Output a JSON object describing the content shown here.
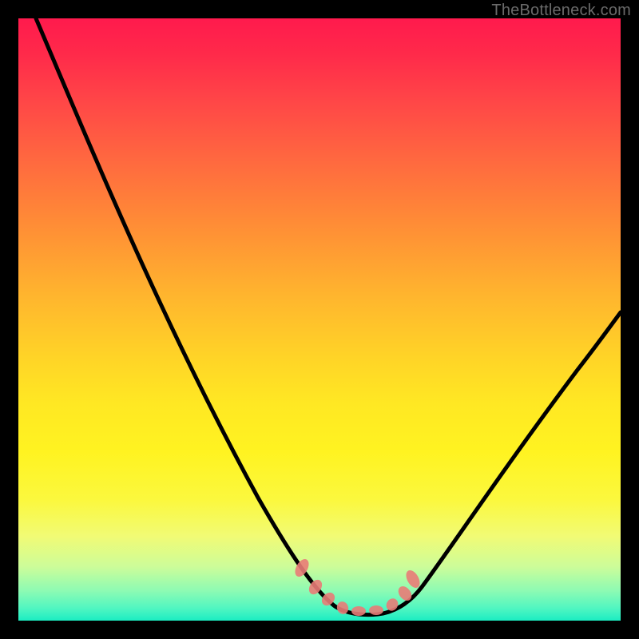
{
  "watermark": "TheBottleneck.com",
  "colors": {
    "frame": "#000000",
    "curve": "#000000",
    "salmon": "#e97b77",
    "gradient_stops": [
      "#ff1a4d",
      "#ff2a4a",
      "#ff4747",
      "#ff6a3f",
      "#ff8c36",
      "#ffb52e",
      "#ffd327",
      "#ffe823",
      "#fff321",
      "#fbf83e",
      "#f1fb75",
      "#cdfc99",
      "#8efbb3",
      "#4ff6c1",
      "#1bedc2"
    ]
  },
  "chart_data": {
    "type": "line",
    "title": "",
    "xlabel": "",
    "ylabel": "",
    "xlim": [
      0,
      100
    ],
    "ylim": [
      0,
      100
    ],
    "grid": false,
    "legend_position": "none",
    "series": [
      {
        "name": "bottleneck-curve",
        "x": [
          3,
          8,
          13,
          18,
          23,
          28,
          33,
          38,
          42,
          45,
          48,
          51,
          53,
          55,
          57,
          60,
          63,
          67,
          72,
          78,
          85,
          92,
          100
        ],
        "y": [
          100,
          91,
          82,
          73,
          64,
          55,
          46,
          37,
          28,
          20,
          13,
          7,
          4,
          2,
          2,
          2,
          3,
          6,
          11,
          19,
          30,
          43,
          58
        ]
      }
    ],
    "annotations": [
      {
        "name": "salmon-marker",
        "shape": "blob",
        "x": 47.5,
        "y": 9
      },
      {
        "name": "salmon-marker",
        "shape": "blob",
        "x": 49.5,
        "y": 6
      },
      {
        "name": "salmon-marker",
        "shape": "blob",
        "x": 51.5,
        "y": 4
      },
      {
        "name": "salmon-marker",
        "shape": "blob",
        "x": 54.0,
        "y": 2.5
      },
      {
        "name": "salmon-marker",
        "shape": "blob",
        "x": 57.0,
        "y": 2.3
      },
      {
        "name": "salmon-marker",
        "shape": "blob",
        "x": 60.0,
        "y": 2.5
      },
      {
        "name": "salmon-marker",
        "shape": "blob",
        "x": 62.5,
        "y": 4
      },
      {
        "name": "salmon-marker",
        "shape": "blob",
        "x": 64.5,
        "y": 6.5
      },
      {
        "name": "salmon-marker",
        "shape": "blob",
        "x": 65.5,
        "y": 9
      }
    ],
    "note": "Values are estimated from pixel positions; the image has no axis ticks or numeric labels, so x/y are normalized 0-100 across the plot area. y=0 is the bottom (green), y=100 is the top (red)."
  }
}
